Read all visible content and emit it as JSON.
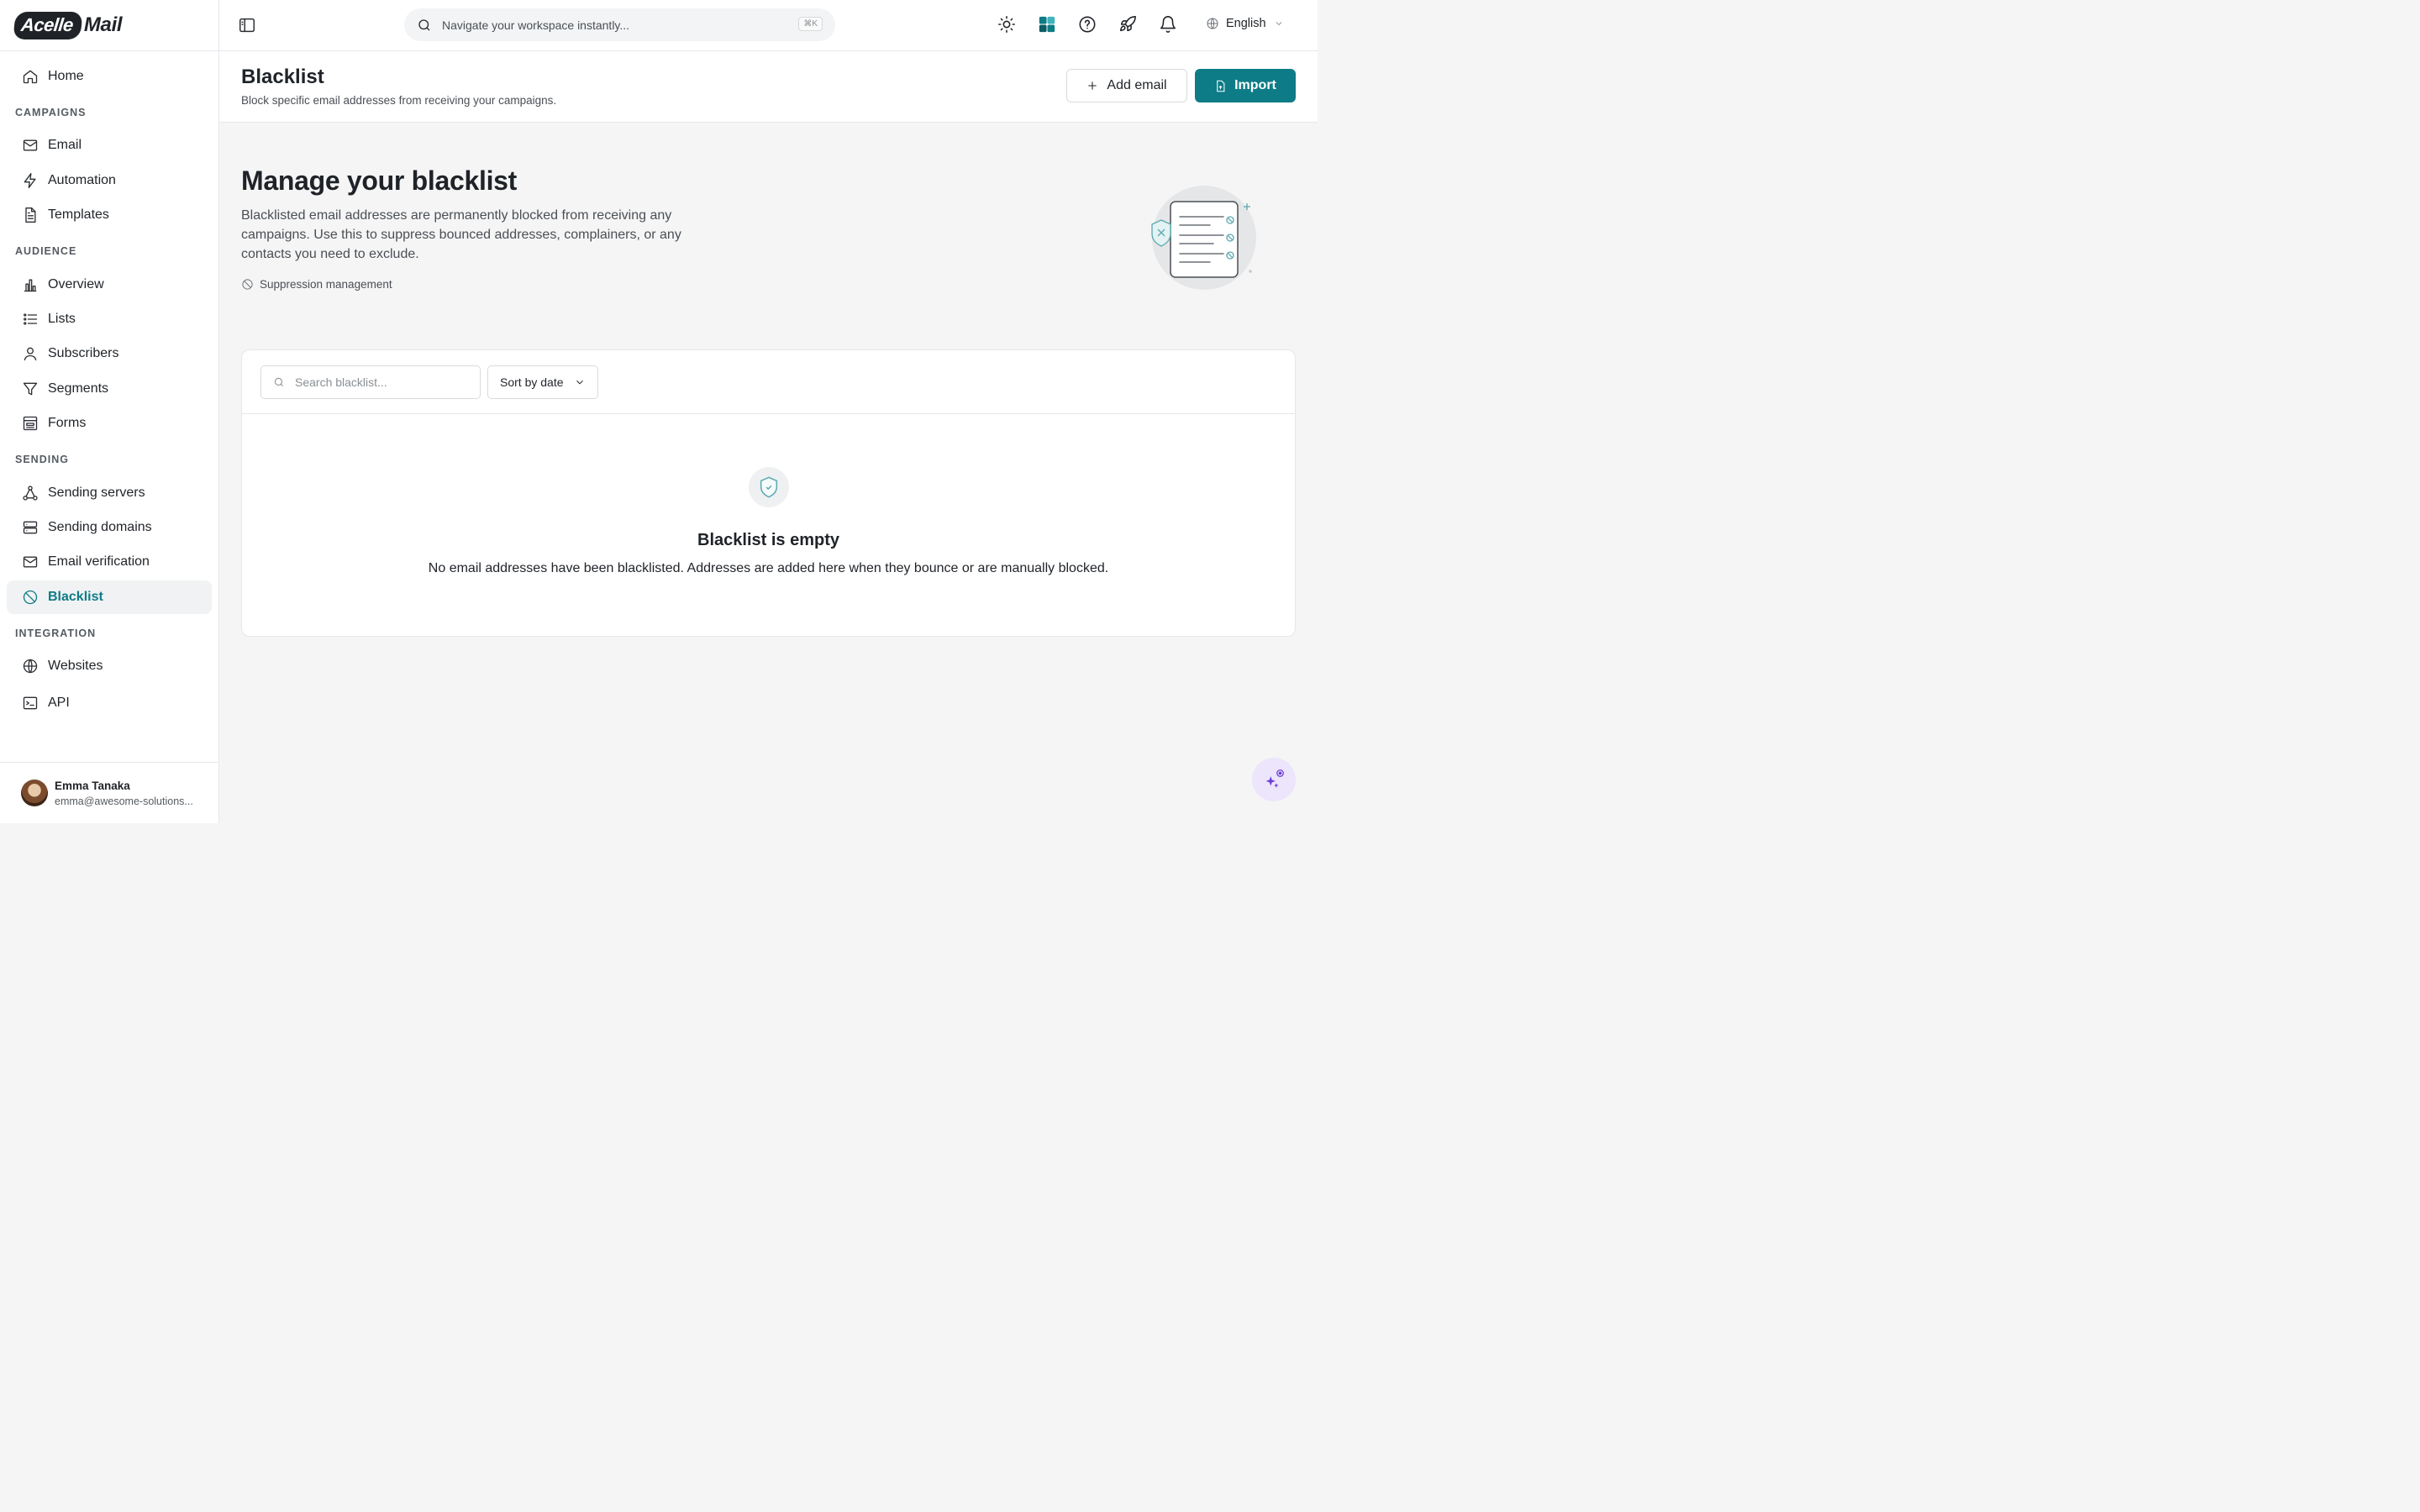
{
  "app": {
    "logo_part1": "Acelle",
    "logo_part2": "Mail"
  },
  "sidebar": {
    "home": "Home",
    "sections": {
      "campaigns": "CAMPAIGNS",
      "audience": "AUDIENCE",
      "sending": "SENDING",
      "integration": "INTEGRATION"
    },
    "items": {
      "email": "Email",
      "automation": "Automation",
      "templates": "Templates",
      "overview": "Overview",
      "lists": "Lists",
      "subscribers": "Subscribers",
      "segments": "Segments",
      "forms": "Forms",
      "sending_servers": "Sending servers",
      "sending_domains": "Sending domains",
      "email_verification": "Email verification",
      "blacklist": "Blacklist",
      "websites": "Websites",
      "api": "API"
    },
    "active_item": "blacklist",
    "user": {
      "name": "Emma Tanaka",
      "email": "emma@awesome-solutions..."
    }
  },
  "topbar": {
    "search_placeholder": "Navigate your workspace instantly...",
    "shortcut": "⌘K",
    "language": "English",
    "icons": [
      "sun-icon",
      "workspace-logo-icon",
      "help-icon",
      "rocket-icon",
      "bell-icon"
    ]
  },
  "header": {
    "title": "Blacklist",
    "subtitle": "Block specific email addresses from receiving your campaigns.",
    "add_button": "Add email",
    "import_button": "Import"
  },
  "hero": {
    "title": "Manage your blacklist",
    "description": "Blacklisted email addresses are permanently blocked from receiving any campaigns. Use this to suppress bounced addresses, complainers, or any contacts you need to exclude.",
    "tag": "Suppression management"
  },
  "list": {
    "search_placeholder": "Search blacklist...",
    "sort_value": "Sort by date",
    "empty_title": "Blacklist is empty",
    "empty_description": "No email addresses have been blacklisted. Addresses are added here when they bounce or are manually blocked."
  },
  "colors": {
    "accent": "#0e7c86",
    "ai_fab_bg": "#ece5fb",
    "ai_fab_icon": "#6d3fd8"
  }
}
